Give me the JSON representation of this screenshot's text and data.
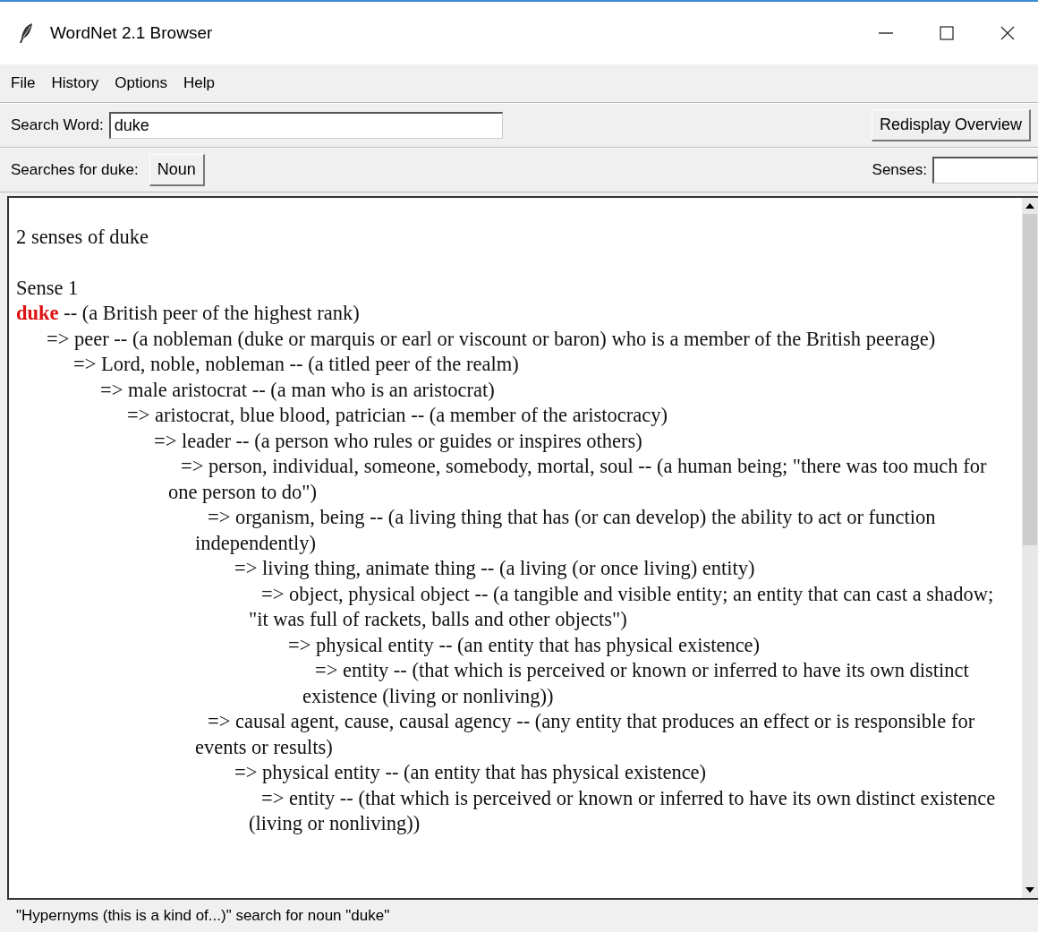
{
  "window": {
    "title": "WordNet 2.1 Browser"
  },
  "menu": [
    "File",
    "History",
    "Options",
    "Help"
  ],
  "search": {
    "label": "Search Word:",
    "value": "duke",
    "button": "Redisplay Overview"
  },
  "searches": {
    "label": "Searches for duke:",
    "buttons": [
      "Noun"
    ],
    "senses_label": "Senses:"
  },
  "output": {
    "heading": "2 senses of duke",
    "sense": "Sense 1",
    "tree": {
      "headword": "duke",
      "gloss": "-- (a British peer of the highest rank)",
      "children": [
        {
          "text": "=> peer -- (a nobleman (duke or marquis or earl or viscount or baron) who is a member of the British peerage)",
          "children": [
            {
              "text": "=> Lord, noble, nobleman -- (a titled peer of the realm)",
              "children": [
                {
                  "text": "=> male aristocrat -- (a man who is an aristocrat)",
                  "children": [
                    {
                      "text": "=> aristocrat, blue blood, patrician -- (a member of the aristocracy)",
                      "children": [
                        {
                          "text": "=> leader -- (a person who rules or guides or inspires others)",
                          "children": [
                            {
                              "text": "=> person, individual, someone, somebody, mortal, soul -- (a human being; \"there was too much for one person to do\")",
                              "children": [
                                {
                                  "text": "=> organism, being -- (a living thing that has (or can develop) the ability to act or function independently)",
                                  "children": [
                                    {
                                      "text": "=> living thing, animate thing -- (a living (or once living) entity)",
                                      "children": [
                                        {
                                          "text": "=> object, physical object -- (a tangible and visible entity; an entity that can cast a shadow; \"it was full of rackets, balls and other objects\")",
                                          "children": [
                                            {
                                              "text": "=> physical entity -- (an entity that has physical existence)",
                                              "children": [
                                                {
                                                  "text": "=> entity -- (that which is perceived or known or inferred to have its own distinct existence (living or nonliving))"
                                                }
                                              ]
                                            }
                                          ]
                                        }
                                      ]
                                    }
                                  ]
                                },
                                {
                                  "text": "=> causal agent, cause, causal agency -- (any entity that produces an effect or is responsible for events or results)",
                                  "children": [
                                    {
                                      "text": "=> physical entity -- (an entity that has physical existence)",
                                      "children": [
                                        {
                                          "text": "=> entity -- (that which is perceived or known or inferred to have its own distinct existence (living or nonliving))"
                                        }
                                      ]
                                    }
                                  ]
                                }
                              ]
                            }
                          ]
                        }
                      ]
                    }
                  ]
                }
              ]
            }
          ]
        }
      ]
    }
  },
  "status_bar": "\"Hypernyms (this is a kind of...)\" search for noun \"duke\""
}
